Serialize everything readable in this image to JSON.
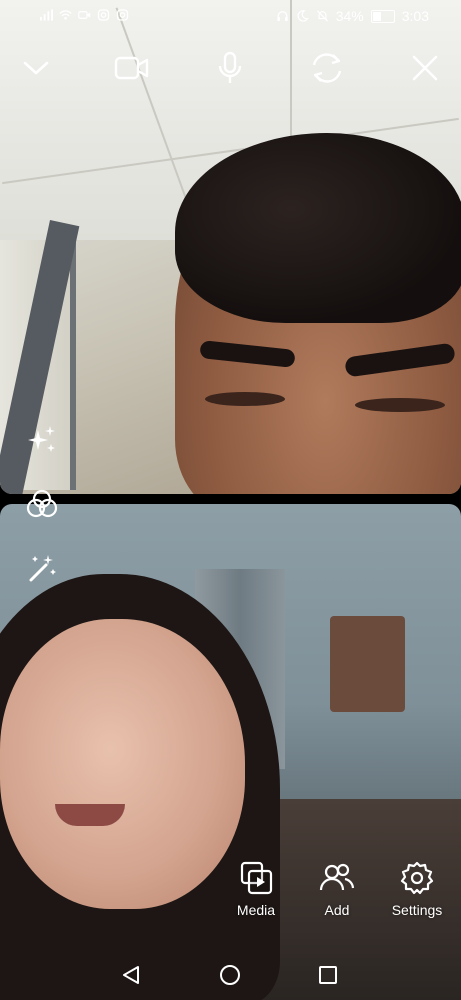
{
  "status_bar": {
    "battery_percent": "34%",
    "time": "3:03",
    "left_icons": [
      "signal-icon",
      "wifi-icon",
      "video-status-icon",
      "instagram-icon",
      "instagram-icon"
    ],
    "right_icons": [
      "headset-icon",
      "moon-icon",
      "mute-bell-icon",
      "battery-icon"
    ]
  },
  "call_controls": {
    "icons": [
      "chevron-down-icon",
      "video-camera-icon",
      "microphone-icon",
      "flip-camera-icon",
      "close-icon"
    ]
  },
  "effects": {
    "icons": [
      "sparkles-icon",
      "filters-icon",
      "magic-wand-icon"
    ]
  },
  "actions": {
    "media_label": "Media",
    "add_label": "Add",
    "settings_label": "Settings"
  },
  "nav_bar": {
    "icons": [
      "back-icon",
      "home-icon",
      "recents-icon"
    ]
  }
}
